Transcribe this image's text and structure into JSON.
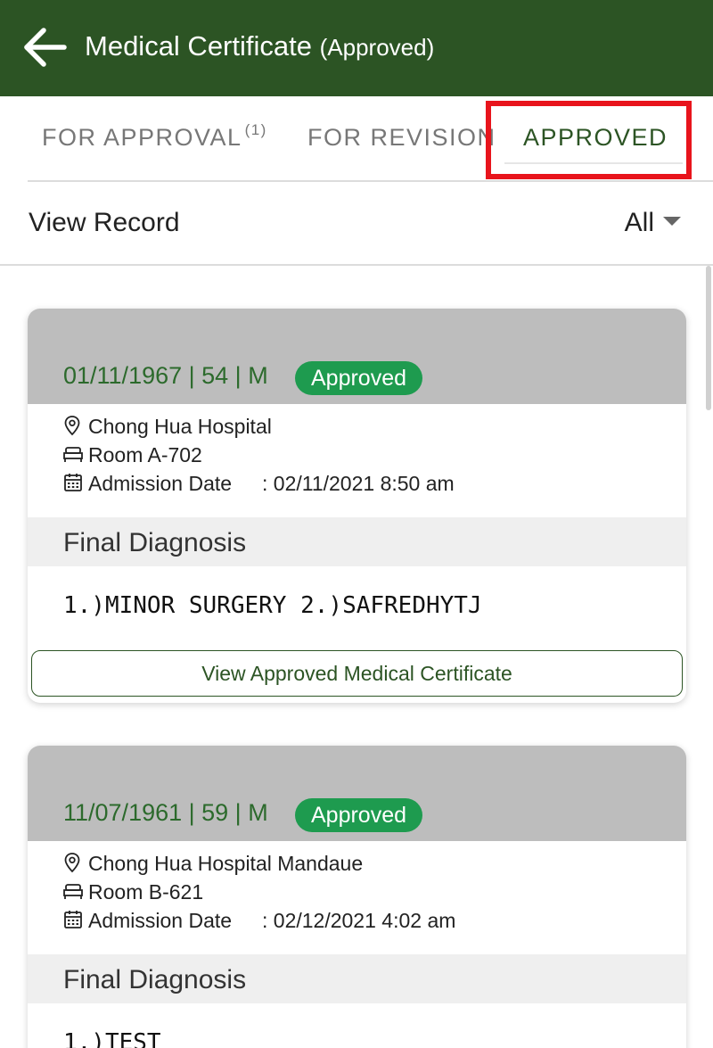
{
  "header": {
    "title": "Medical Certificate",
    "subtitle": "(Approved)"
  },
  "tabs": [
    {
      "label": "FOR APPROVAL",
      "count": "(1)"
    },
    {
      "label": "FOR REVISION"
    },
    {
      "label": "APPROVED",
      "active": true
    }
  ],
  "view": {
    "label": "View Record",
    "filter": "All"
  },
  "records": [
    {
      "patient": "01/11/1967 | 54 | M",
      "status": "Approved",
      "hospital": "Chong Hua Hospital",
      "room": "Room A-702",
      "admission_label": "Admission Date",
      "admission_value": ": 02/11/2021 8:50 am",
      "diagnosis_title": "Final Diagnosis",
      "diagnosis": "1.)MINOR SURGERY 2.)SAFREDHYTJ",
      "button_label": "View Approved Medical Certificate"
    },
    {
      "patient": "11/07/1961 | 59 | M",
      "status": "Approved",
      "hospital": "Chong Hua Hospital Mandaue",
      "room": "Room B-621",
      "admission_label": "Admission Date",
      "admission_value": ": 02/12/2021 4:02 am",
      "diagnosis_title": "Final Diagnosis",
      "diagnosis": "1.)TEST"
    }
  ],
  "colors": {
    "header_bg": "#2c5424",
    "accent": "#2c5424",
    "badge": "#1e9b4f",
    "highlight": "#e8141c",
    "card_head": "#bdbdbd"
  },
  "icons": [
    "back-arrow-icon",
    "location-pin-icon",
    "bed-icon",
    "calendar-icon",
    "caret-down-icon"
  ]
}
